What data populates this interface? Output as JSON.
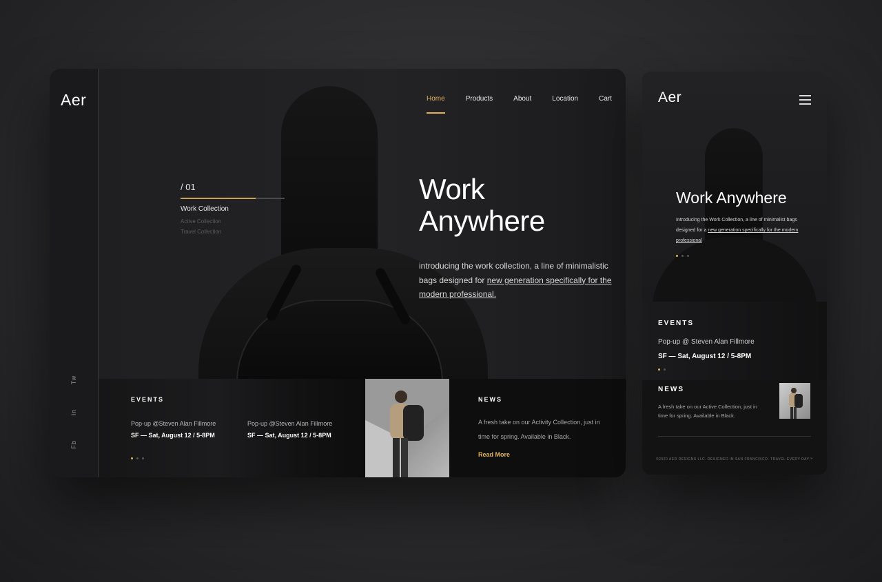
{
  "brand": "Aer",
  "desktop": {
    "nav": [
      {
        "label": "Home",
        "active": true
      },
      {
        "label": "Products",
        "active": false
      },
      {
        "label": "About",
        "active": false
      },
      {
        "label": "Location",
        "active": false
      },
      {
        "label": "Cart",
        "active": false
      }
    ],
    "socials": [
      "Tw",
      "In",
      "Fb"
    ],
    "slider": {
      "index": "/ 01",
      "progress": 0.72,
      "current": "Work Collection",
      "items": [
        "Active Collection",
        "Travel Collection"
      ]
    },
    "hero": {
      "title_line1": "Work",
      "title_line2": "Anywhere",
      "intro_text": "introducing the work collection, a line of minimalistic bags designed for ",
      "intro_link": "new generation specifically for the modern professional."
    },
    "events": {
      "label": "EVENTS",
      "items": [
        {
          "title": "Pop-up @Steven Alan Fillmore",
          "date": "SF — Sat, August 12 / 5-8PM"
        },
        {
          "title": "Pop-up @Steven Alan Fillmore",
          "date": "SF — Sat, August 12 / 5-8PM"
        }
      ]
    },
    "news": {
      "label": "NEWS",
      "text": "A fresh take on our Activity Collection, just in time for spring. Available in Black.",
      "link": "Read More"
    }
  },
  "mobile": {
    "hero": {
      "title": "Work Anywhere",
      "intro_text": "Introducing the Work Collection, a line of minimalist bags designed for a ",
      "intro_link": "new generation specifically for the modern professional"
    },
    "events": {
      "label": "EVENTS",
      "title": "Pop-up @ Steven Alan Fillmore",
      "date": "SF — Sat, August 12 / 5-8PM"
    },
    "news": {
      "label": "NEWS",
      "text": "A fresh take on our Active Collection, just in time for spring. Available in Black."
    },
    "copyright": "©2020 AER DESIGNS LLC. DESIGNED IN SAN FRANCISCO. TRAVEL EVERY DAY™"
  },
  "colors": {
    "accent": "#e2b35e",
    "background": "#2a2a2c",
    "panel": "#1e1e20"
  },
  "icons": [
    "search-icon",
    "menu-icon"
  ]
}
